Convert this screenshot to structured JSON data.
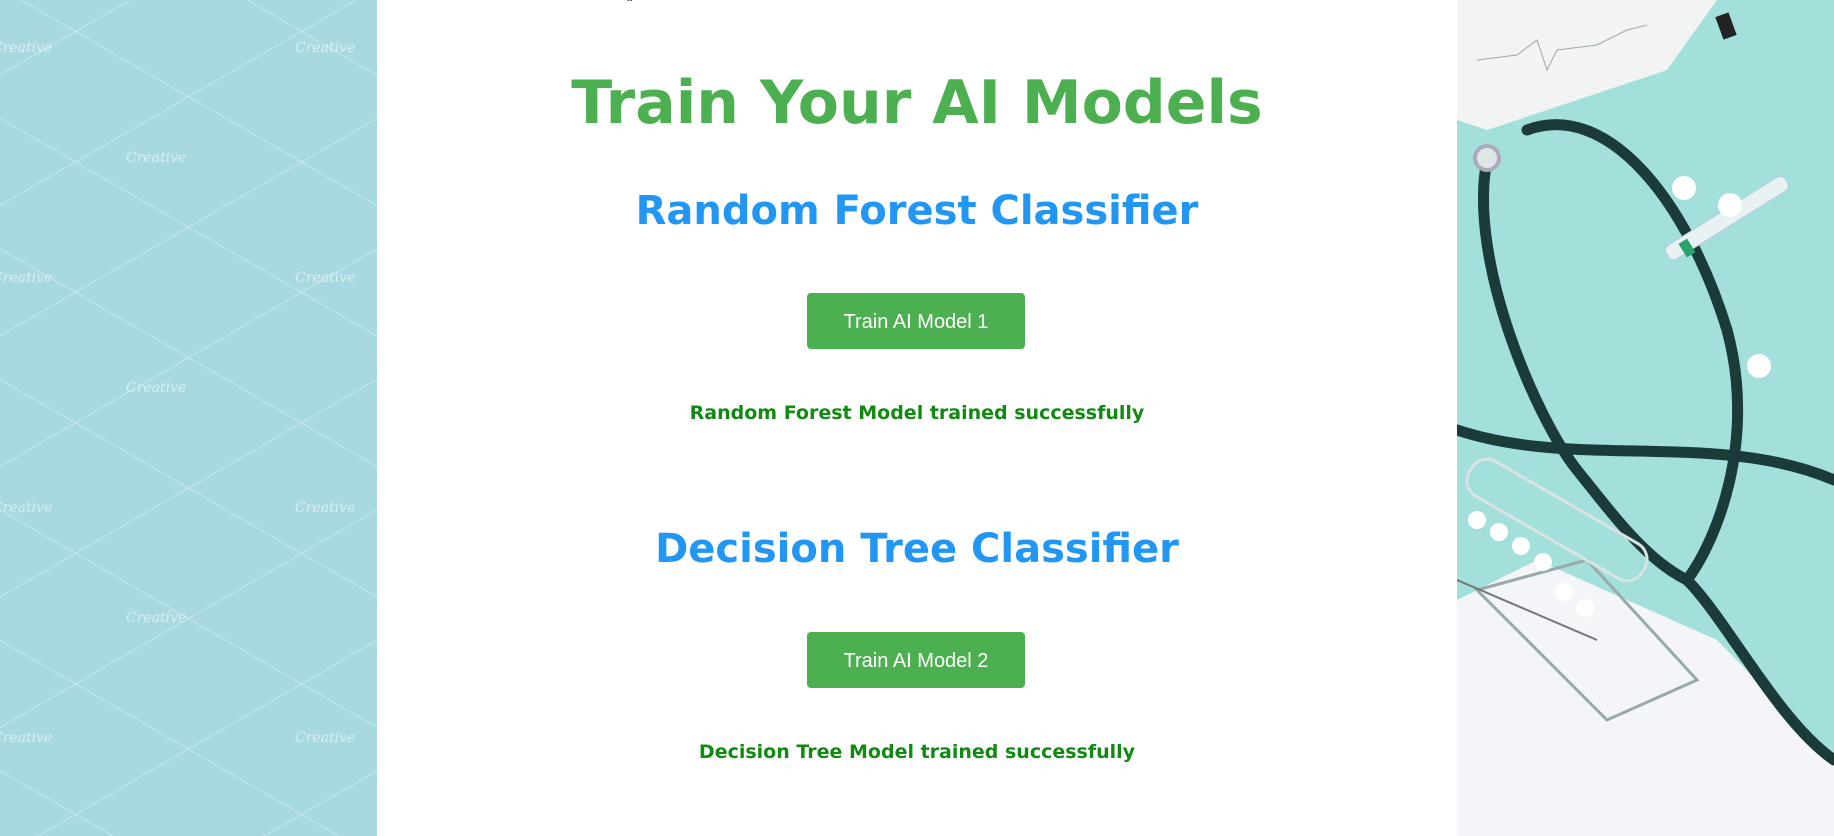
{
  "page": {
    "title": "Train Your AI Models",
    "cut_off_text": "y                         ,"
  },
  "sections": [
    {
      "heading": "Random Forest Classifier",
      "button_label": "Train AI Model 1",
      "status_message": "Random Forest Model trained successfully"
    },
    {
      "heading": "Decision Tree Classifier",
      "button_label": "Train AI Model 2",
      "status_message": "Decision Tree Model trained successfully"
    }
  ],
  "background": {
    "watermark_text": "Creative",
    "left_color": "#a8d9e0",
    "right_icons": [
      "stethoscope-icon",
      "pill-icon",
      "syringe-icon",
      "clipboard-icon",
      "ecg-paper-icon"
    ]
  },
  "colors": {
    "title": "#4caf50",
    "heading": "#2196f3",
    "button": "#4caf50",
    "success": "#118a11"
  }
}
